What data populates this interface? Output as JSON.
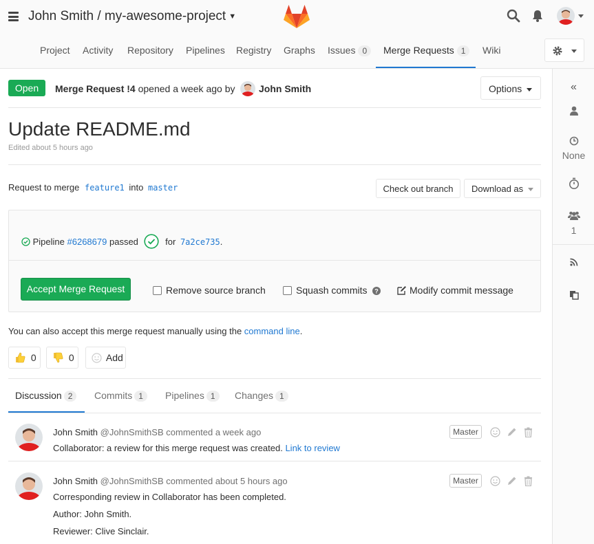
{
  "header": {
    "project_title": "John Smith / my-awesome-project"
  },
  "nav": {
    "items": [
      {
        "label": "Project"
      },
      {
        "label": "Activity"
      },
      {
        "label": "Repository"
      },
      {
        "label": "Pipelines"
      },
      {
        "label": "Registry"
      },
      {
        "label": "Graphs"
      },
      {
        "label": "Issues",
        "count": "0"
      },
      {
        "label": "Merge Requests",
        "count": "1"
      },
      {
        "label": "Wiki"
      }
    ]
  },
  "mr": {
    "state": "Open",
    "ref": "Merge Request !4",
    "opened_text": "opened a week ago by",
    "author": "John Smith",
    "options_label": "Options",
    "title": "Update README.md",
    "edited": "Edited about 5 hours ago",
    "request_prefix": "Request to merge",
    "source_branch": "feature1",
    "into_word": "into",
    "target_branch": "master",
    "checkout_label": "Check out branch",
    "download_label": "Download as"
  },
  "widget": {
    "pipeline_prefix": "Pipeline",
    "pipeline_id": "#6268679",
    "pipeline_status": "passed",
    "for_word": "for",
    "commit_sha": "7a2ce735",
    "period": ".",
    "accept_label": "Accept Merge Request",
    "remove_source_label": "Remove source branch",
    "squash_label": "Squash commits",
    "modify_commit_label": "Modify commit message"
  },
  "manual": {
    "text": "You can also accept this merge request manually using the",
    "link": "command line",
    "end": "."
  },
  "awards": {
    "thumbsup_count": "0",
    "thumbsdown_count": "0",
    "add_label": "Add"
  },
  "tabs": [
    {
      "label": "Discussion",
      "count": "2"
    },
    {
      "label": "Commits",
      "count": "1"
    },
    {
      "label": "Pipelines",
      "count": "1"
    },
    {
      "label": "Changes",
      "count": "1"
    }
  ],
  "sidebar": {
    "milestone": "None",
    "participants_count": "1"
  },
  "notes": [
    {
      "author": "John Smith",
      "handle": "@JohnSmithSB",
      "action": "commented",
      "time": "a week ago",
      "role": "Master",
      "body_text": "Collaborator: a review for this merge request was created.",
      "body_link": "Link to review"
    },
    {
      "author": "John Smith",
      "handle": "@JohnSmithSB",
      "action": "commented",
      "time": "about 5 hours ago",
      "role": "Master",
      "lines": [
        "Corresponding review in Collaborator has been completed.",
        "Author: John Smith.",
        "Reviewer: Clive Sinclair."
      ]
    }
  ],
  "colors": {
    "accent": "#1f78d1",
    "success": "#1aaa55",
    "logo_orange": "#fc6d26",
    "logo_red": "#e24329"
  }
}
